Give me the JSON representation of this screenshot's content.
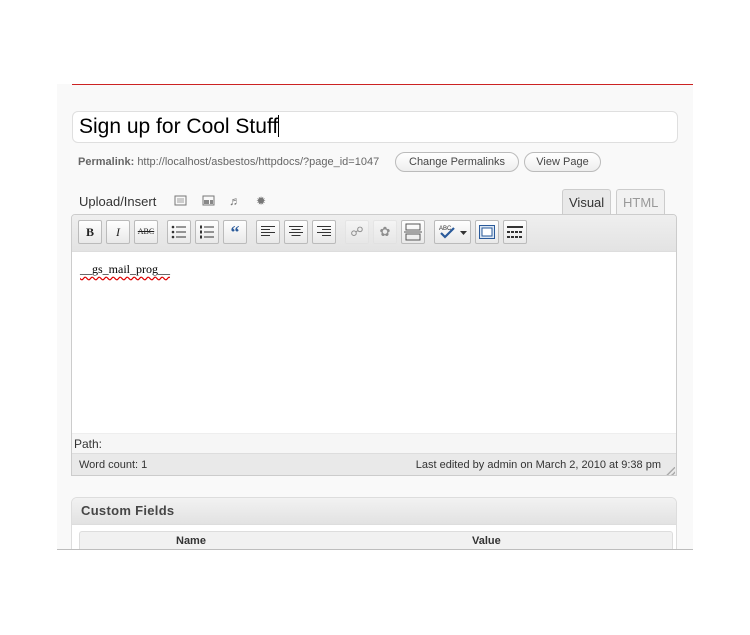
{
  "post": {
    "title": "Sign up for Cool Stuff",
    "permalink_label": "Permalink:",
    "permalink_url": "http://localhost/asbestos/httpdocs/?page_id=1047",
    "change_permalinks_label": "Change Permalinks",
    "view_page_label": "View Page"
  },
  "media": {
    "upload_insert_label": "Upload/Insert",
    "icons": [
      "image-icon",
      "video-icon",
      "audio-icon",
      "media-icon"
    ]
  },
  "editor": {
    "tabs": [
      {
        "label": "Visual",
        "active": true
      },
      {
        "label": "HTML",
        "active": false
      }
    ],
    "toolbar": [
      "bold",
      "italic",
      "strikethrough",
      "bullet-list",
      "numbered-list",
      "blockquote",
      "align-left",
      "align-center",
      "align-right",
      "link",
      "unlink",
      "insert-more",
      "spellcheck",
      "fullscreen",
      "kitchen-sink"
    ],
    "content": "__gs_mail_prog__",
    "path_label": "Path:",
    "word_count": "Word count: 1",
    "last_edited": "Last edited by admin on March 2, 2010 at 9:38 pm"
  },
  "custom_fields": {
    "title": "Custom Fields",
    "columns": [
      "Name",
      "Value"
    ]
  },
  "colors": {
    "accent_line": "#cc2222",
    "active_tab": "#e9e9e9"
  }
}
